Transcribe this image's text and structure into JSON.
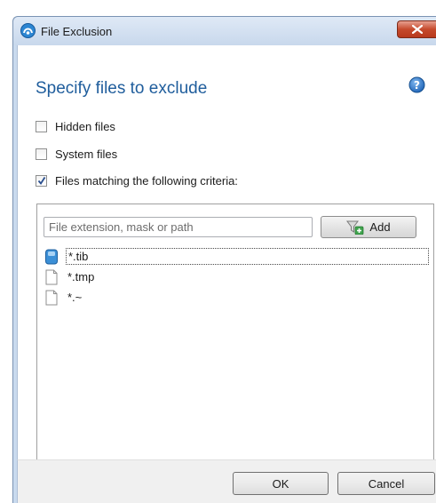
{
  "window": {
    "title": "File Exclusion",
    "icon": "acronis-app-icon",
    "close_icon": "close-icon"
  },
  "header": {
    "title": "Specify files to exclude",
    "help_icon": "help-icon"
  },
  "options": [
    {
      "label": "Hidden files",
      "checked": false
    },
    {
      "label": "System files",
      "checked": false
    },
    {
      "label": "Files matching the following criteria:",
      "checked": true
    }
  ],
  "criteria": {
    "input_placeholder": "File extension, mask or path",
    "input_value": "",
    "add_label": "Add",
    "add_icon": "filter-add-icon",
    "items": [
      {
        "label": "*.tib",
        "icon": "tib-archive-icon",
        "selected": true
      },
      {
        "label": "*.tmp",
        "icon": "file-icon",
        "selected": false
      },
      {
        "label": "*.~",
        "icon": "file-icon",
        "selected": false
      }
    ]
  },
  "footer": {
    "ok_label": "OK",
    "cancel_label": "Cancel"
  },
  "colors": {
    "heading": "#1f5d9c",
    "titlebar": "#c9daee",
    "close": "#c54a2c"
  }
}
